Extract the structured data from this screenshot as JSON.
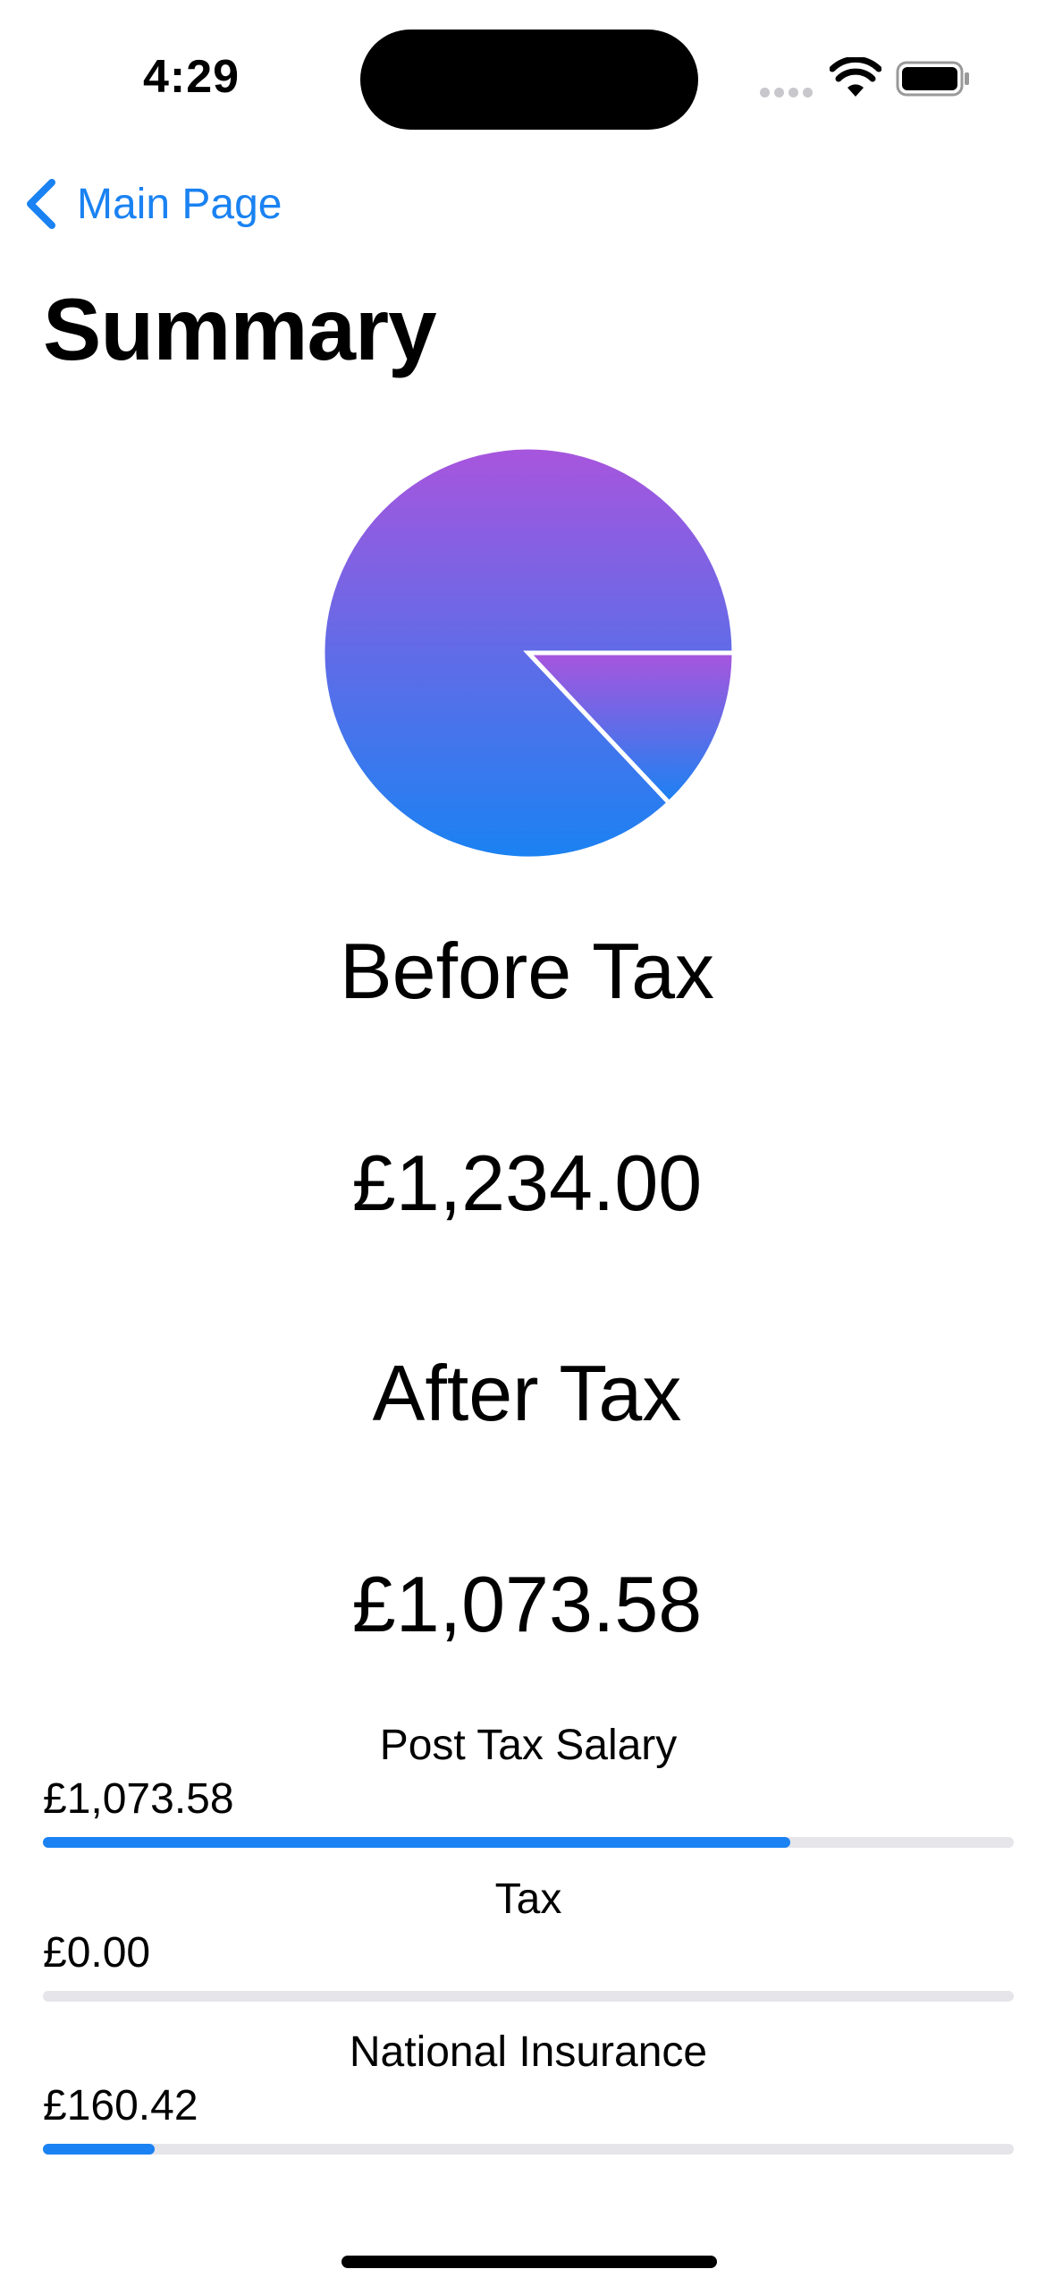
{
  "status_bar": {
    "time": "4:29"
  },
  "nav": {
    "back_label": "Main Page"
  },
  "page": {
    "title": "Summary"
  },
  "chart_data": {
    "type": "pie",
    "slices": [
      {
        "label": "Post Tax Salary",
        "value": 1073.58
      },
      {
        "label": "Tax",
        "value": 0.0
      },
      {
        "label": "National Insurance",
        "value": 160.42
      }
    ],
    "colors": {
      "gradient_top": "#a855dd",
      "gradient_bottom": "#1a82f2",
      "separator": "#ffffff"
    }
  },
  "summary": {
    "before_tax_label": "Before Tax",
    "before_tax_value": "£1,234.00",
    "after_tax_label": "After Tax",
    "after_tax_value": "£1,073.58"
  },
  "breakdown": [
    {
      "title": "Post Tax Salary",
      "value": "£1,073.58",
      "fraction": 0.77
    },
    {
      "title": "Tax",
      "value": "£0.00",
      "fraction": 0.0
    },
    {
      "title": "National Insurance",
      "value": "£160.42",
      "fraction": 0.115
    }
  ],
  "colors": {
    "accent": "#1a82f2",
    "track": "#e5e5ea"
  },
  "icons": {
    "back": "chevron-left-icon",
    "wifi": "wifi-icon",
    "battery": "battery-icon"
  }
}
